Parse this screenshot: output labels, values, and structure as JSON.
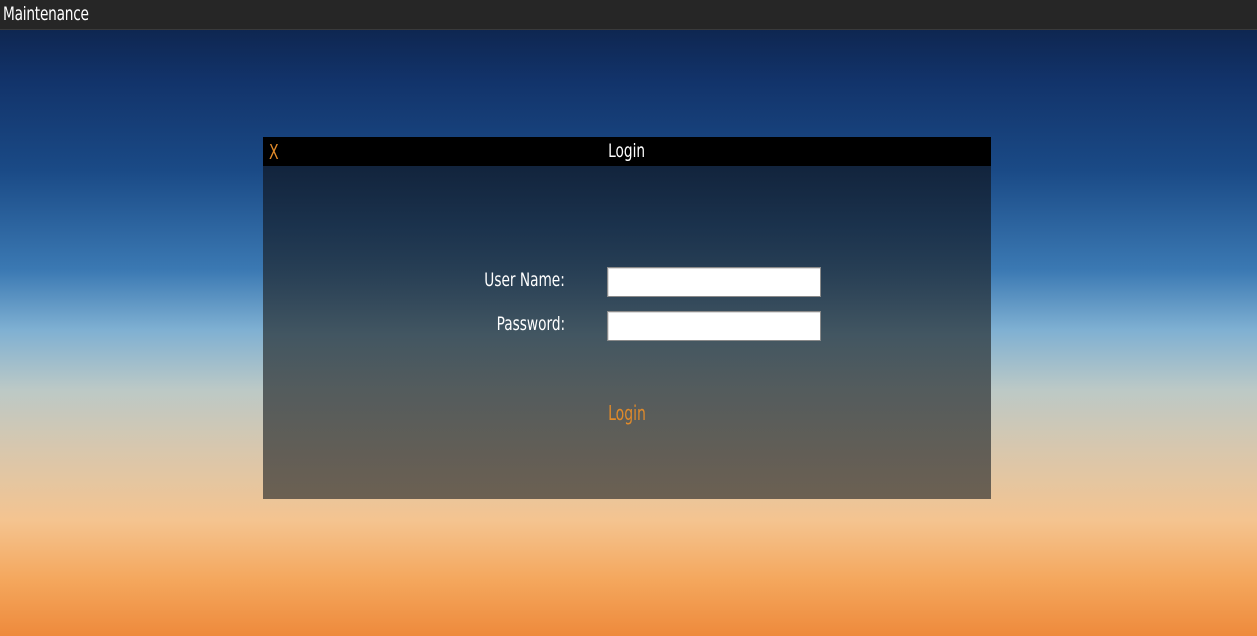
{
  "app": {
    "title": "Maintenance"
  },
  "dialog": {
    "close_label": "X",
    "title": "Login",
    "username_label": "User Name:",
    "username_value": "",
    "password_label": "Password:",
    "password_value": "",
    "login_label": "Login"
  },
  "colors": {
    "accent": "#e08a2a",
    "titlebar": "#262626",
    "dialog_header": "#000000"
  }
}
